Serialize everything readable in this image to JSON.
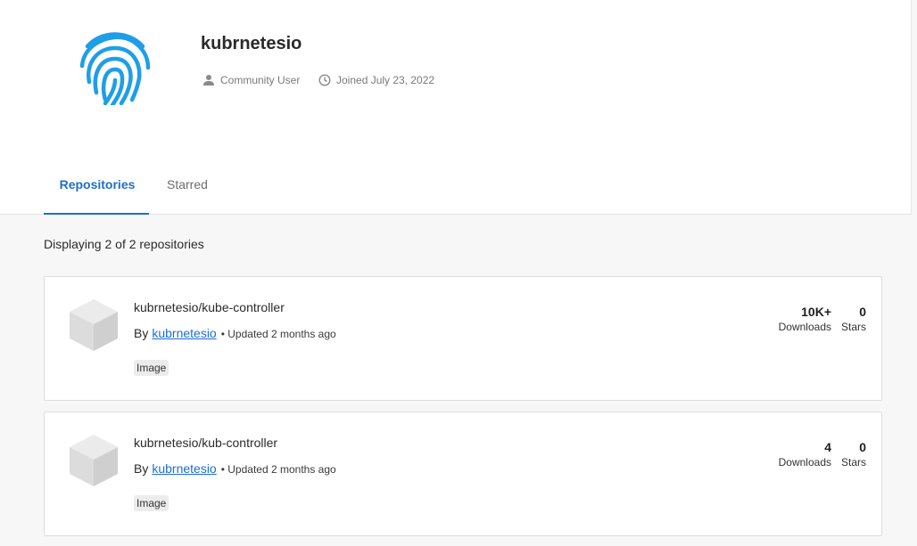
{
  "profile": {
    "username": "kubrnetesio",
    "user_type": "Community User",
    "joined": "Joined July 23, 2022",
    "avatar_icon": "fingerprint-icon",
    "accent_color": "#1e9ee8"
  },
  "tabs": [
    {
      "label": "Repositories",
      "active": true
    },
    {
      "label": "Starred",
      "active": false
    }
  ],
  "listing": {
    "count_text": "Displaying 2 of 2 repositories"
  },
  "repositories": [
    {
      "name": "kubrnetesio/kube-controller",
      "by_prefix": "By",
      "owner": "kubrnetesio",
      "updated": "• Updated 2 months ago",
      "badge": "Image",
      "downloads": "10K+",
      "downloads_label": "Downloads",
      "stars": "0",
      "stars_label": "Stars"
    },
    {
      "name": "kubrnetesio/kub-controller",
      "by_prefix": "By",
      "owner": "kubrnetesio",
      "updated": "• Updated 2 months ago",
      "badge": "Image",
      "downloads": "4",
      "downloads_label": "Downloads",
      "stars": "0",
      "stars_label": "Stars"
    }
  ]
}
